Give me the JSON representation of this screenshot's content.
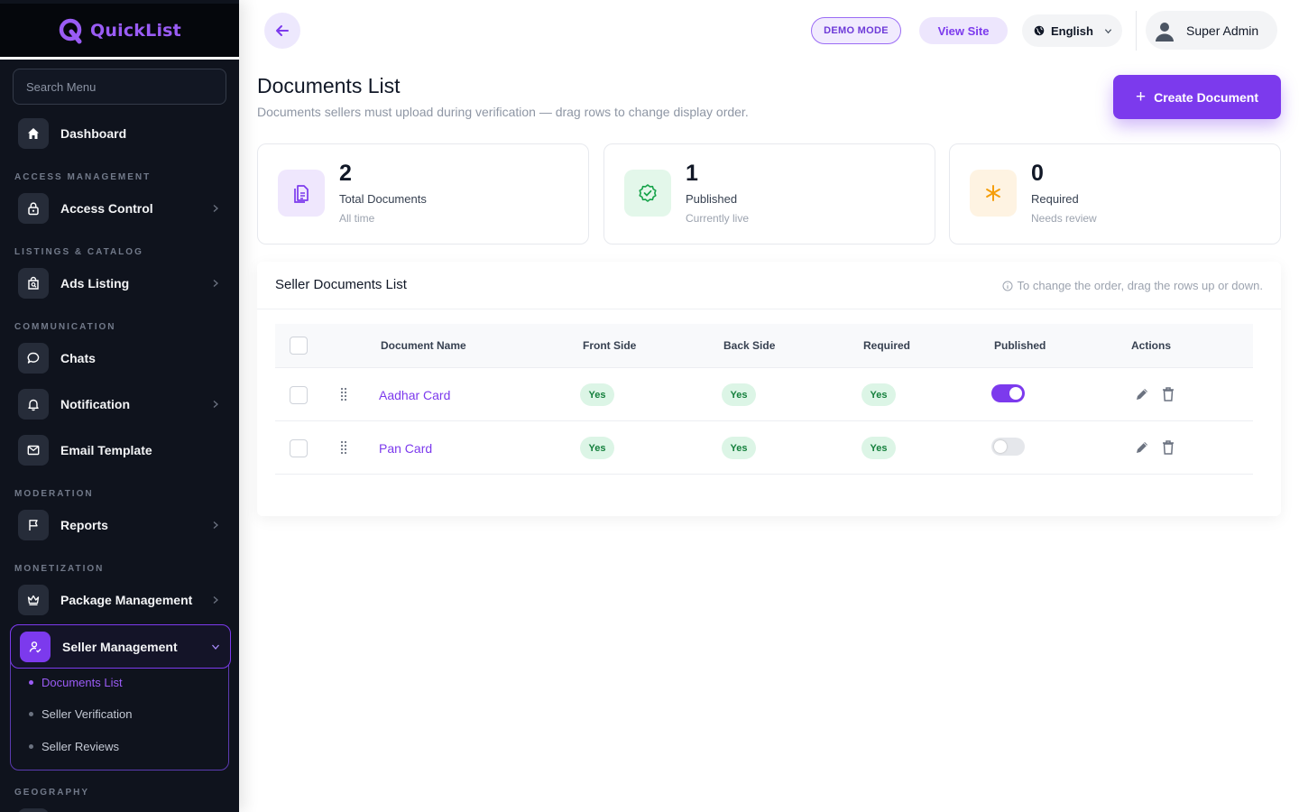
{
  "app": {
    "name": "QuickList"
  },
  "sidebar": {
    "search_placeholder": "Search Menu",
    "dashboard": "Dashboard",
    "sections": {
      "access": "ACCESS MANAGEMENT",
      "listings": "LISTINGS & CATALOG",
      "communication": "COMMUNICATION",
      "moderation": "MODERATION",
      "monetization": "MONETIZATION",
      "geography": "GEOGRAPHY"
    },
    "items": {
      "access_control": "Access Control",
      "ads_listing": "Ads Listing",
      "chats": "Chats",
      "notification": "Notification",
      "email_template": "Email Template",
      "reports": "Reports",
      "package_management": "Package Management",
      "seller_management": "Seller Management"
    },
    "seller_sub": {
      "documents_list": "Documents List",
      "seller_verification": "Seller Verification",
      "seller_reviews": "Seller Reviews"
    }
  },
  "topbar": {
    "demo_badge": "DEMO MODE",
    "view_site": "View Site",
    "language": "English",
    "user": "Super Admin"
  },
  "page": {
    "title": "Documents List",
    "subtitle": "Documents sellers must upload during verification — drag rows to change display order.",
    "create_button": "Create Document"
  },
  "stats": [
    {
      "value": "2",
      "label": "Total Documents",
      "hint": "All time",
      "icon": "document-icon",
      "color": "#7c3aed"
    },
    {
      "value": "1",
      "label": "Published",
      "hint": "Currently live",
      "icon": "verified-badge-icon",
      "color": "#16a34a"
    },
    {
      "value": "0",
      "label": "Required",
      "hint": "Needs review",
      "icon": "asterisk-icon",
      "color": "#f59e0b"
    }
  ],
  "table": {
    "title": "Seller Documents List",
    "hint": "To change the order, drag the rows up or down.",
    "columns": [
      "Document Name",
      "Front Side",
      "Back Side",
      "Required",
      "Published",
      "Actions"
    ],
    "rows": [
      {
        "name": "Aadhar Card",
        "front": "Yes",
        "back": "Yes",
        "required": "Yes",
        "published": true
      },
      {
        "name": "Pan Card",
        "front": "Yes",
        "back": "Yes",
        "required": "Yes",
        "published": false
      }
    ]
  },
  "colors": {
    "accent": "#7c3aed",
    "sidebar_bg": "#0f131d",
    "success": "#15803d"
  }
}
